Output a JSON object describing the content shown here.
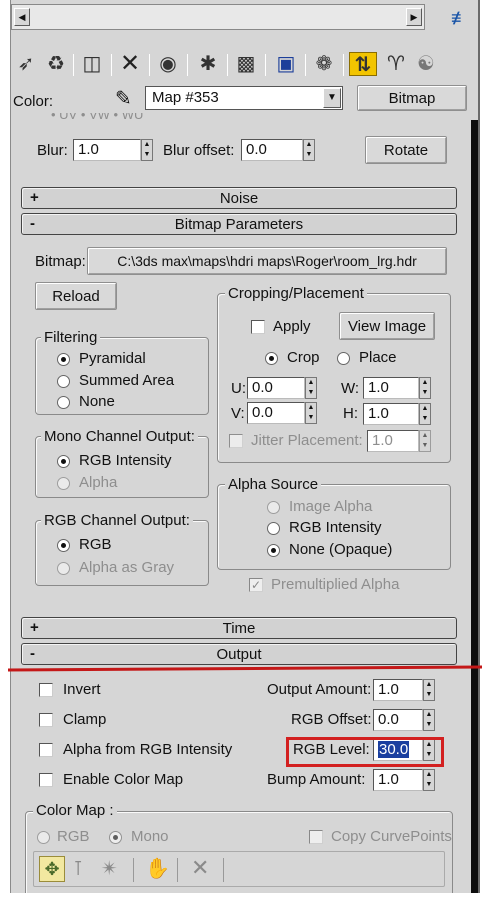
{
  "colors": {
    "panel": "#d6d6d6",
    "highlight_box": "#d32020",
    "divider_line": "#c41818",
    "selection": "#1a3f9f"
  },
  "header": {
    "color_label": "Color:",
    "map_name": "Map #353",
    "map_type_button": "Bitmap"
  },
  "toolbar": {
    "icons": [
      "pick-material-icon",
      "put-to-scene-icon",
      "assign-material-icon",
      "delete-icon",
      "make-unique-icon",
      "put-to-library-icon",
      "material-id-icon",
      "show-map-icon",
      "show-end-result-icon",
      "go-to-parent-icon",
      "go-forward-icon",
      "select-by-material-icon"
    ]
  },
  "blur_row": {
    "blur_label": "Blur:",
    "blur_value": "1.0",
    "offset_label": "Blur offset:",
    "offset_value": "0.0",
    "rotate_button": "Rotate"
  },
  "rollouts": {
    "noise": {
      "sign": "+",
      "title": "Noise"
    },
    "bitmap_params": {
      "sign": "-",
      "title": "Bitmap Parameters"
    },
    "time": {
      "sign": "+",
      "title": "Time"
    },
    "output": {
      "sign": "-",
      "title": "Output"
    }
  },
  "bitmap": {
    "label": "Bitmap:",
    "path": "C:\\3ds max\\maps\\hdri maps\\Roger\\room_lrg.hdr",
    "reload_button": "Reload"
  },
  "filtering": {
    "title": "Filtering",
    "options": [
      "Pyramidal",
      "Summed Area",
      "None"
    ],
    "selected": "Pyramidal"
  },
  "mono_channel": {
    "title": "Mono Channel Output:",
    "options": [
      "RGB Intensity",
      "Alpha"
    ],
    "selected": "RGB Intensity"
  },
  "rgb_channel": {
    "title": "RGB Channel Output:",
    "options": [
      "RGB",
      "Alpha as Gray"
    ],
    "selected": "RGB"
  },
  "cropping": {
    "title": "Cropping/Placement",
    "apply_label": "Apply",
    "view_image_button": "View Image",
    "crop_label": "Crop",
    "place_label": "Place",
    "mode": "Crop",
    "u_label": "U:",
    "u_value": "0.0",
    "w_label": "W:",
    "w_value": "1.0",
    "v_label": "V:",
    "v_value": "0.0",
    "h_label": "H:",
    "h_value": "1.0",
    "jitter_label": "Jitter Placement:",
    "jitter_value": "1.0"
  },
  "alpha_source": {
    "title": "Alpha Source",
    "options": [
      "Image Alpha",
      "RGB Intensity",
      "None (Opaque)"
    ],
    "selected": "None (Opaque)",
    "premultiplied_label": "Premultiplied Alpha"
  },
  "output": {
    "invert_label": "Invert",
    "clamp_label": "Clamp",
    "alpha_from_rgb_label": "Alpha from RGB Intensity",
    "enable_color_map_label": "Enable Color Map",
    "output_amount_label": "Output Amount:",
    "output_amount_value": "1.0",
    "rgb_offset_label": "RGB Offset:",
    "rgb_offset_value": "0.0",
    "rgb_level_label": "RGB Level:",
    "rgb_level_value": "30.0",
    "bump_amount_label": "Bump Amount:",
    "bump_amount_value": "1.0"
  },
  "color_map": {
    "title": "Color Map :",
    "rgb_label": "RGB",
    "mono_label": "Mono",
    "mode": "Mono",
    "copy_curve_label": "Copy CurvePoints"
  },
  "partial_top_text": "• UV  • VW  • WU"
}
